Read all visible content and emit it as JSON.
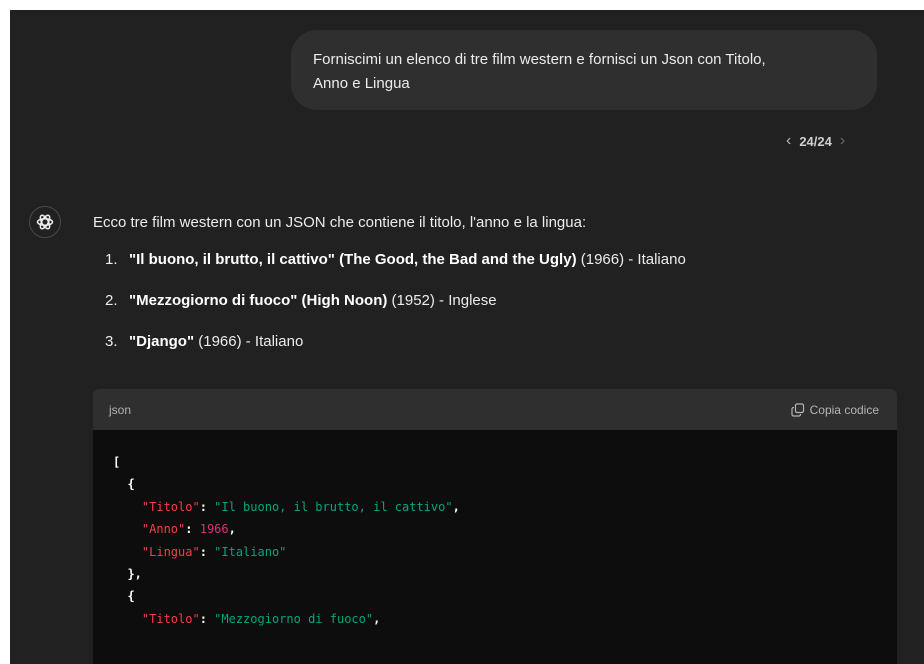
{
  "user_message": {
    "line1": "Forniscimi un elenco di tre film western e fornisci un Json con Titolo,",
    "line2": "Anno e Lingua"
  },
  "pager": {
    "count": "24/24",
    "prev_icon": "chevron-left",
    "next_icon": "chevron-right"
  },
  "assistant": {
    "avatar_icon": "openai-logo",
    "intro": "Ecco tre film western con un JSON che contiene il titolo, l'anno e la lingua:",
    "films": [
      {
        "number": "1.",
        "title": "\"Il buono, il brutto, il cattivo\"",
        "english": "(The Good, the Bad and the Ugly)",
        "details": "(1966) - Italiano"
      },
      {
        "number": "2.",
        "title": "\"Mezzogiorno di fuoco\"",
        "english": "(High Noon)",
        "details": "(1952) - Inglese"
      },
      {
        "number": "3.",
        "title": "\"Django\"",
        "english": "",
        "details": "(1966) - Italiano"
      }
    ]
  },
  "code_block": {
    "language": "json",
    "copy_label": "Copia codice",
    "copy_icon": "copy-icon",
    "keys": {
      "titolo": "\"Titolo\"",
      "anno": "\"Anno\"",
      "lingua": "\"Lingua\""
    },
    "values": {
      "titolo_1": "\"Il buono, il brutto, il cattivo\"",
      "anno_1": "1966",
      "lingua_1": "\"Italiano\"",
      "titolo_2": "\"Mezzogiorno di fuoco\""
    },
    "tokens": {
      "open_bracket": "[",
      "open_brace": "{",
      "close_brace_comma": "},",
      "colon": ": ",
      "comma": ","
    }
  },
  "colors": {
    "background": "#212121",
    "user_bubble": "#2f2f2f",
    "code_background": "#0d0d0d",
    "code_header": "#2f2f2f",
    "json_key": "#ef4146",
    "json_string": "#00a67d",
    "json_number": "#df3079"
  }
}
